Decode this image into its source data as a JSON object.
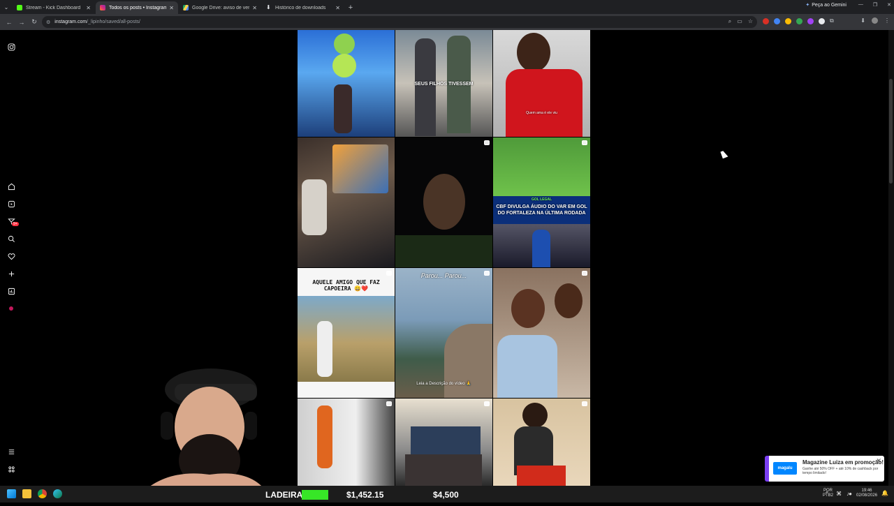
{
  "browser": {
    "tabs": [
      {
        "title": "Stream - Kick Dashboard",
        "icon": "kick-icon",
        "color": "#53fc18",
        "active": false
      },
      {
        "title": "Todos os posts • Instagram",
        "icon": "instagram-icon",
        "color": "#e1306c",
        "active": true
      },
      {
        "title": "Google Drive: aviso de verificaç",
        "icon": "google-drive-icon",
        "color": "#1fa463",
        "active": false
      },
      {
        "title": "Histórico de downloads",
        "icon": "download-icon",
        "color": "#e8eaed",
        "active": false
      }
    ],
    "gemini_label": "Peça ao Gemini",
    "url_domain": "instagram.com",
    "url_path": "/_lipinho/saved/all-posts/"
  },
  "posts": {
    "row1": [
      "SEUS FILHOS TIVESSEM",
      "Quem ama é ele viu"
    ],
    "row2": [
      "GOL LEGAL",
      "CBF DIVULGA ÁUDIO DO VAR EM GOL DO FORTALEZA NA ÚLTIMA RODADA"
    ],
    "row3": [
      "AQUELE AMIGO QUE FAZ CAPOEIRA 😄❤️",
      "Parou... Parou...",
      "Leia a Descrição do vídeo 🙏"
    ]
  },
  "stream_overlay": {
    "label": "LADEIRA",
    "value1": "$1,452.15",
    "value2": "$4,500"
  },
  "toast": {
    "brand": "magalu",
    "title": "Magazine Luiza em promoção!",
    "body": "Ganhe até 50% OFF + até 10% de cashback por tempo limitado!"
  },
  "tray": {
    "lang1": "POR",
    "lang2": "PTB2",
    "time": "19:46",
    "date": "02/08/2026"
  }
}
